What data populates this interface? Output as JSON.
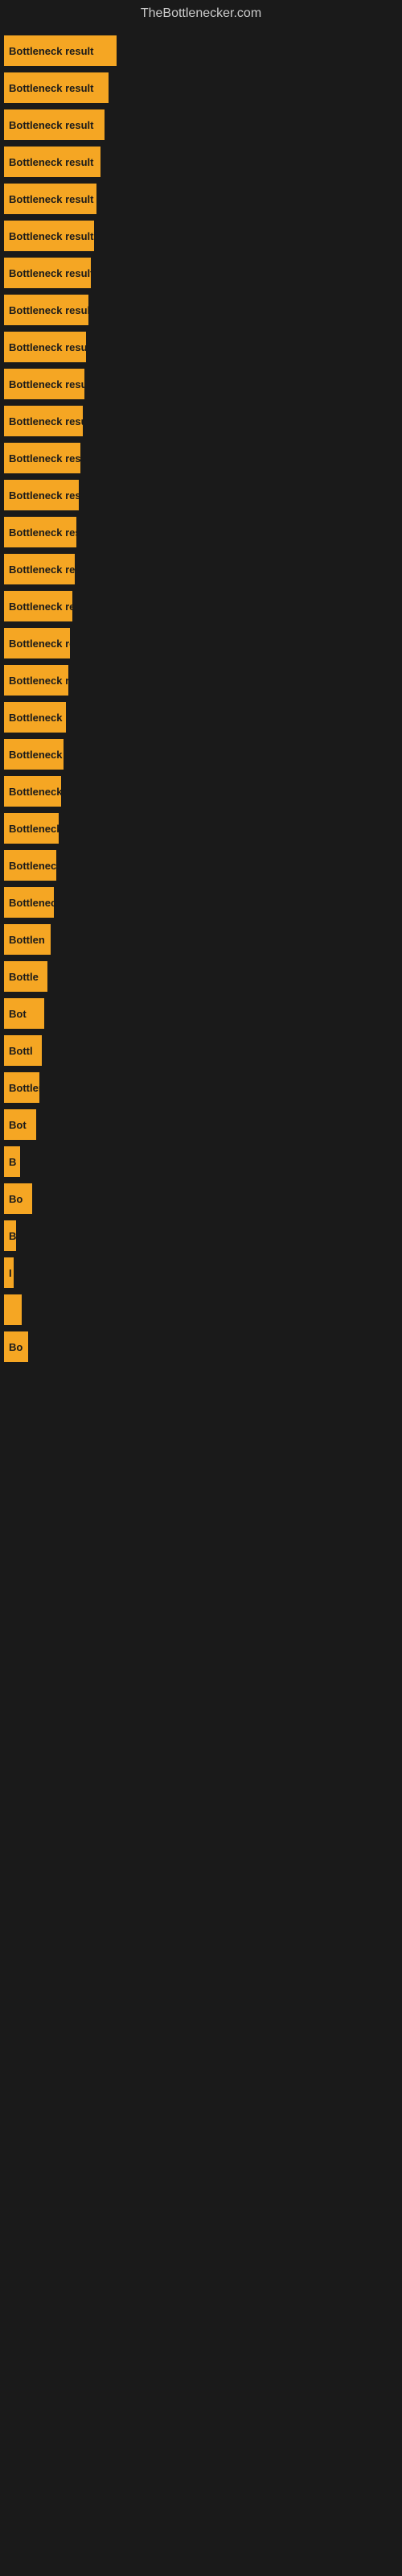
{
  "site": {
    "title": "TheBottlenecker.com"
  },
  "bars": [
    {
      "label": "Bottleneck result",
      "width": 140
    },
    {
      "label": "Bottleneck result",
      "width": 130
    },
    {
      "label": "Bottleneck result",
      "width": 125
    },
    {
      "label": "Bottleneck result",
      "width": 120
    },
    {
      "label": "Bottleneck result",
      "width": 115
    },
    {
      "label": "Bottleneck result",
      "width": 112
    },
    {
      "label": "Bottleneck result",
      "width": 108
    },
    {
      "label": "Bottleneck result",
      "width": 105
    },
    {
      "label": "Bottleneck result",
      "width": 102
    },
    {
      "label": "Bottleneck result",
      "width": 100
    },
    {
      "label": "Bottleneck result",
      "width": 98
    },
    {
      "label": "Bottleneck result",
      "width": 95
    },
    {
      "label": "Bottleneck result",
      "width": 93
    },
    {
      "label": "Bottleneck result",
      "width": 90
    },
    {
      "label": "Bottleneck result",
      "width": 88
    },
    {
      "label": "Bottleneck result",
      "width": 85
    },
    {
      "label": "Bottleneck result",
      "width": 82
    },
    {
      "label": "Bottleneck resu",
      "width": 80
    },
    {
      "label": "Bottleneck r",
      "width": 77
    },
    {
      "label": "Bottleneck resu",
      "width": 74
    },
    {
      "label": "Bottleneck re",
      "width": 71
    },
    {
      "label": "Bottleneck result",
      "width": 68
    },
    {
      "label": "Bottleneck",
      "width": 65
    },
    {
      "label": "Bottleneck resu",
      "width": 62
    },
    {
      "label": "Bottlen",
      "width": 58
    },
    {
      "label": "Bottle",
      "width": 54
    },
    {
      "label": "Bot",
      "width": 50
    },
    {
      "label": "Bottl",
      "width": 47
    },
    {
      "label": "Bottlene",
      "width": 44
    },
    {
      "label": "Bot",
      "width": 40
    },
    {
      "label": "B",
      "width": 20
    },
    {
      "label": "Bo",
      "width": 35
    },
    {
      "label": "B",
      "width": 15
    },
    {
      "label": "I",
      "width": 10
    },
    {
      "label": "",
      "width": 22
    },
    {
      "label": "Bo",
      "width": 30
    }
  ]
}
